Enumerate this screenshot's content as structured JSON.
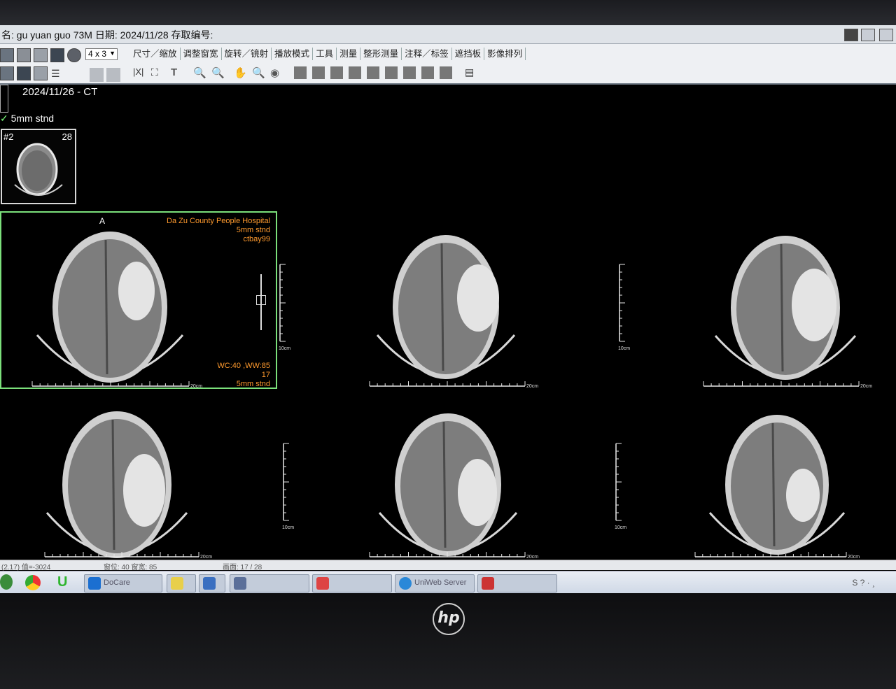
{
  "window": {
    "title": "名: gu yuan guo 73M 日期: 2024/11/28 存取编号:"
  },
  "toolbar": {
    "layout_value": "4 x 3",
    "menu_items": [
      "尺寸／缩放",
      "调整窗宽",
      "旋转／镜射",
      "播放模式",
      "工具",
      "测量",
      "整形测量",
      "注释／标签",
      "遮挡板",
      "影像排列"
    ]
  },
  "series_panel": {
    "study_label": "2024/11/26 - CT",
    "series_check": "✓",
    "series_name": "5mm stnd",
    "thumb_series_no": "#2",
    "thumb_image_count": "28"
  },
  "viewport_overlay": {
    "orientation": "A",
    "hospital": "Da Zu County People  Hospital",
    "slice_thickness": "5mm stnd",
    "station": "ctbay99",
    "window_level": "WC:40 ,WW:85",
    "image_number": "17",
    "slice_thickness_bottom": "5mm stnd"
  },
  "scale_labels": {
    "vertical": "10cm",
    "horizontal": "20cm"
  },
  "status_bar": {
    "pixel_value": "(2.17) 值=-3024",
    "window": "窗位: 40  窗宽: 85",
    "image_index": "画面: 17 / 28"
  },
  "taskbar": {
    "apps": [
      "DoCare",
      "",
      "",
      "",
      "",
      "UniWeb Server",
      ""
    ],
    "tray": "S ? ·  ¸"
  },
  "monitor": {
    "brand": "hp"
  },
  "colors": {
    "active_viewport_border": "#7be07b",
    "annotation": "#ff9a2e",
    "series_check": "#7cff7c"
  }
}
